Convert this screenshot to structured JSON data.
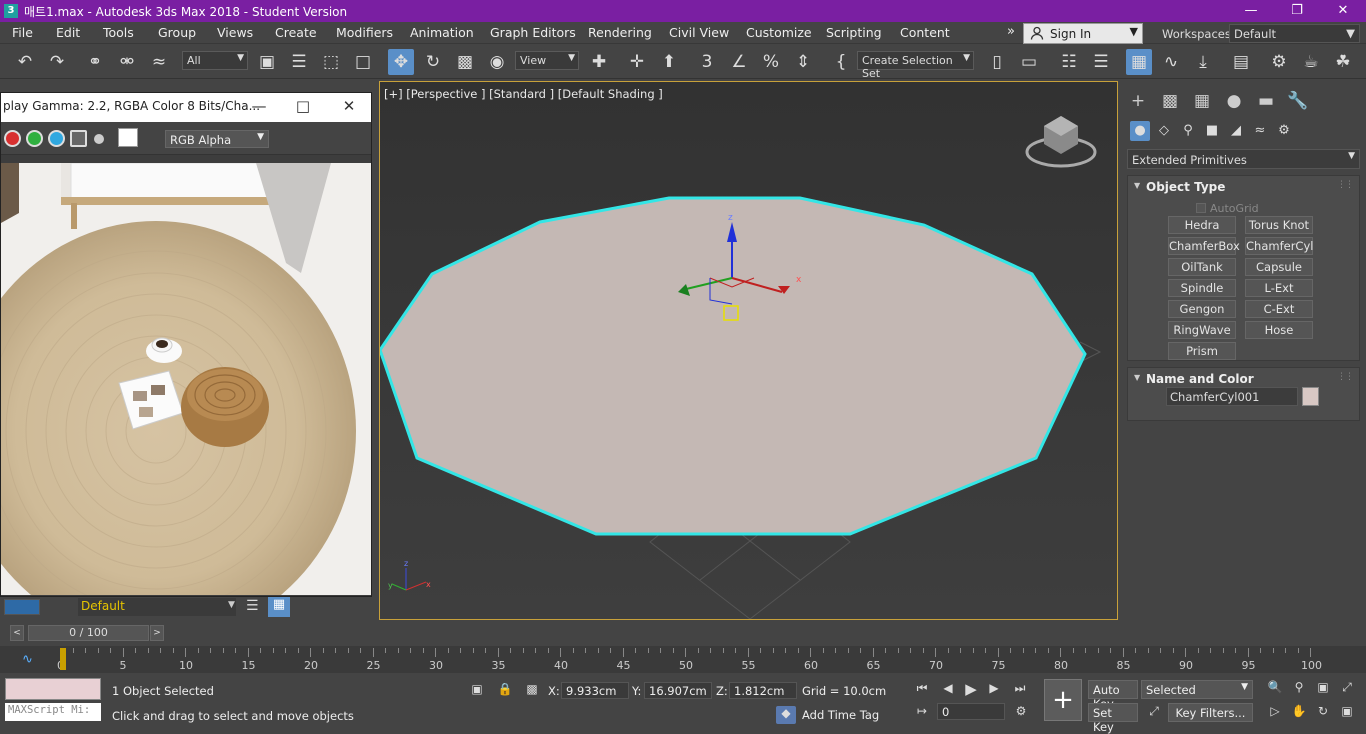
{
  "window": {
    "title": "매트1.max - Autodesk 3ds Max 2018 - Student Version",
    "icon_text": "3"
  },
  "menu": [
    "File",
    "Edit",
    "Tools",
    "Group",
    "Views",
    "Create",
    "Modifiers",
    "Animation",
    "Graph Editors",
    "Rendering",
    "Civil View",
    "Customize",
    "Scripting",
    "Content"
  ],
  "signin": {
    "label": "Sign In"
  },
  "workspaces": {
    "label": "Workspaces:",
    "value": "Default"
  },
  "toolbar": {
    "filter": "All",
    "refcoord": "View",
    "selection_set": "Create Selection Set"
  },
  "frame_buffer": {
    "title": "play Gamma: 2.2, RGBA Color 8 Bits/Cha...",
    "channel": "RGB Alpha",
    "dot_colors": [
      "#d83030",
      "#30b040",
      "#30a8e0"
    ]
  },
  "viewport": {
    "label": "[+] [Perspective ] [Standard ] [Default Shading ]",
    "axis_x": "x",
    "axis_y": "y",
    "axis_z": "z",
    "object_color": "#c4b8b4",
    "selection_color": "#33e6e6"
  },
  "command_panel": {
    "category": "Extended Primitives",
    "object_type": {
      "title": "Object Type",
      "autogrid": "AutoGrid",
      "buttons": [
        "Hedra",
        "Torus Knot",
        "ChamferBox",
        "ChamferCyl",
        "OilTank",
        "Capsule",
        "Spindle",
        "L-Ext",
        "Gengon",
        "C-Ext",
        "RingWave",
        "Hose",
        "Prism"
      ]
    },
    "name_color": {
      "title": "Name and Color",
      "name": "ChamferCyl001",
      "color": "#d8c8c4"
    }
  },
  "layer": {
    "name": "Default"
  },
  "time": {
    "slider": "0 / 100",
    "ticks": [
      "0",
      "5",
      "10",
      "15",
      "20",
      "25",
      "30",
      "35",
      "40",
      "45",
      "50",
      "55",
      "60",
      "65",
      "70",
      "75",
      "80",
      "85",
      "90",
      "95",
      "100"
    ]
  },
  "status": {
    "selected": "1 Object Selected",
    "prompt": "Click and drag to select and move objects",
    "maxscript": "MAXScript Mi:",
    "x_label": "X:",
    "x": "9.933cm",
    "y_label": "Y:",
    "y": "16.907cm",
    "z_label": "Z:",
    "z": "1.812cm",
    "grid": "Grid = 10.0cm",
    "add_time_tag": "Add Time Tag",
    "frame": "0",
    "auto_key": "Auto Key",
    "set_key": "Set Key",
    "key_mode": "Selected",
    "key_filters": "Key Filters..."
  }
}
